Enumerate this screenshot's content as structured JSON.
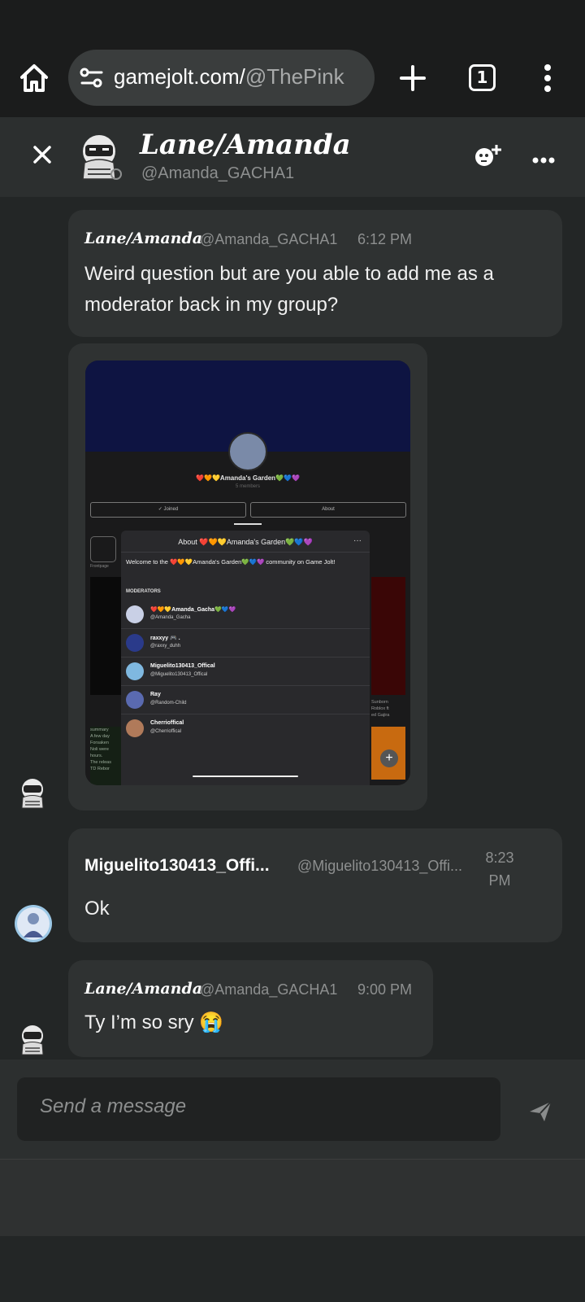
{
  "browser": {
    "url_host": "gamejolt.com/",
    "url_path": "@ThePink",
    "tab_count": "1",
    "icons": [
      "home-icon",
      "site-settings-icon",
      "new-tab-icon",
      "tab-switcher-icon",
      "more-vert-icon"
    ]
  },
  "chat_header": {
    "title": "Lane/Amanda",
    "handle": "@Amanda_GACHA1",
    "icons": [
      "close-icon",
      "add-friend-icon",
      "more-horiz-icon"
    ]
  },
  "messages": [
    {
      "name": "Lane/Amanda",
      "handle": "@Amanda_GACHA1",
      "time": "6:12 PM",
      "text": "Weird question but are you able to add me as a moderator back in my group?"
    },
    {
      "name": "Miguelito130413_Offi...",
      "handle": "@Miguelito130413_Offi...",
      "time": "8:23 PM",
      "text": "Ok"
    },
    {
      "name": "Lane/Amanda",
      "handle": "@Amanda_GACHA1",
      "time": "9:00 PM",
      "text": "Ty I’m so sry 😭"
    }
  ],
  "screenshot": {
    "group_title": "❤️🧡💛Amanda's Garden💚💙💜",
    "members": "5 members",
    "joined_label": "Joined",
    "about_label": "About",
    "frontpage_label": "Frontpage",
    "sheet_title": "About ❤️🧡💛Amanda's Garden💚💙💜",
    "sheet_more": "···",
    "welcome_text": "Welcome to the ❤️🧡💛Amanda's Garden💚💙💜 community on Game Jolt!",
    "moderators_label": "MODERATORS",
    "moderators": [
      {
        "name": "❤️🧡💛Amanda_Gacha💚💙💜",
        "handle": "@Amanda_Gacha"
      },
      {
        "name": "raxxyy 🎮 .",
        "handle": "@raxxy_duhh"
      },
      {
        "name": "Miguelito130413_Offical",
        "handle": "@Miguelito130413_Offical"
      },
      {
        "name": "Ray",
        "handle": "@Random-Child"
      },
      {
        "name": "Cherrioffical",
        "handle": "@Cherrioffical"
      }
    ],
    "left_card_text": [
      "summary",
      "A few day",
      "Forsaken",
      "Noli were",
      "hours.",
      "The releas",
      "TD Rebor"
    ],
    "right_card_text": [
      "Sunborn",
      "Roblox ft",
      "ed Gajira"
    ],
    "plus_label": "+"
  },
  "composer": {
    "placeholder": "Send a message",
    "icons": [
      "send-icon"
    ]
  },
  "colors": {
    "page_bg": "#232626",
    "bubble_bg": "#2f3232",
    "header_bg": "#2c2f2f",
    "browser_bg": "#1b1c1c",
    "muted_text": "#8d8f8f"
  }
}
